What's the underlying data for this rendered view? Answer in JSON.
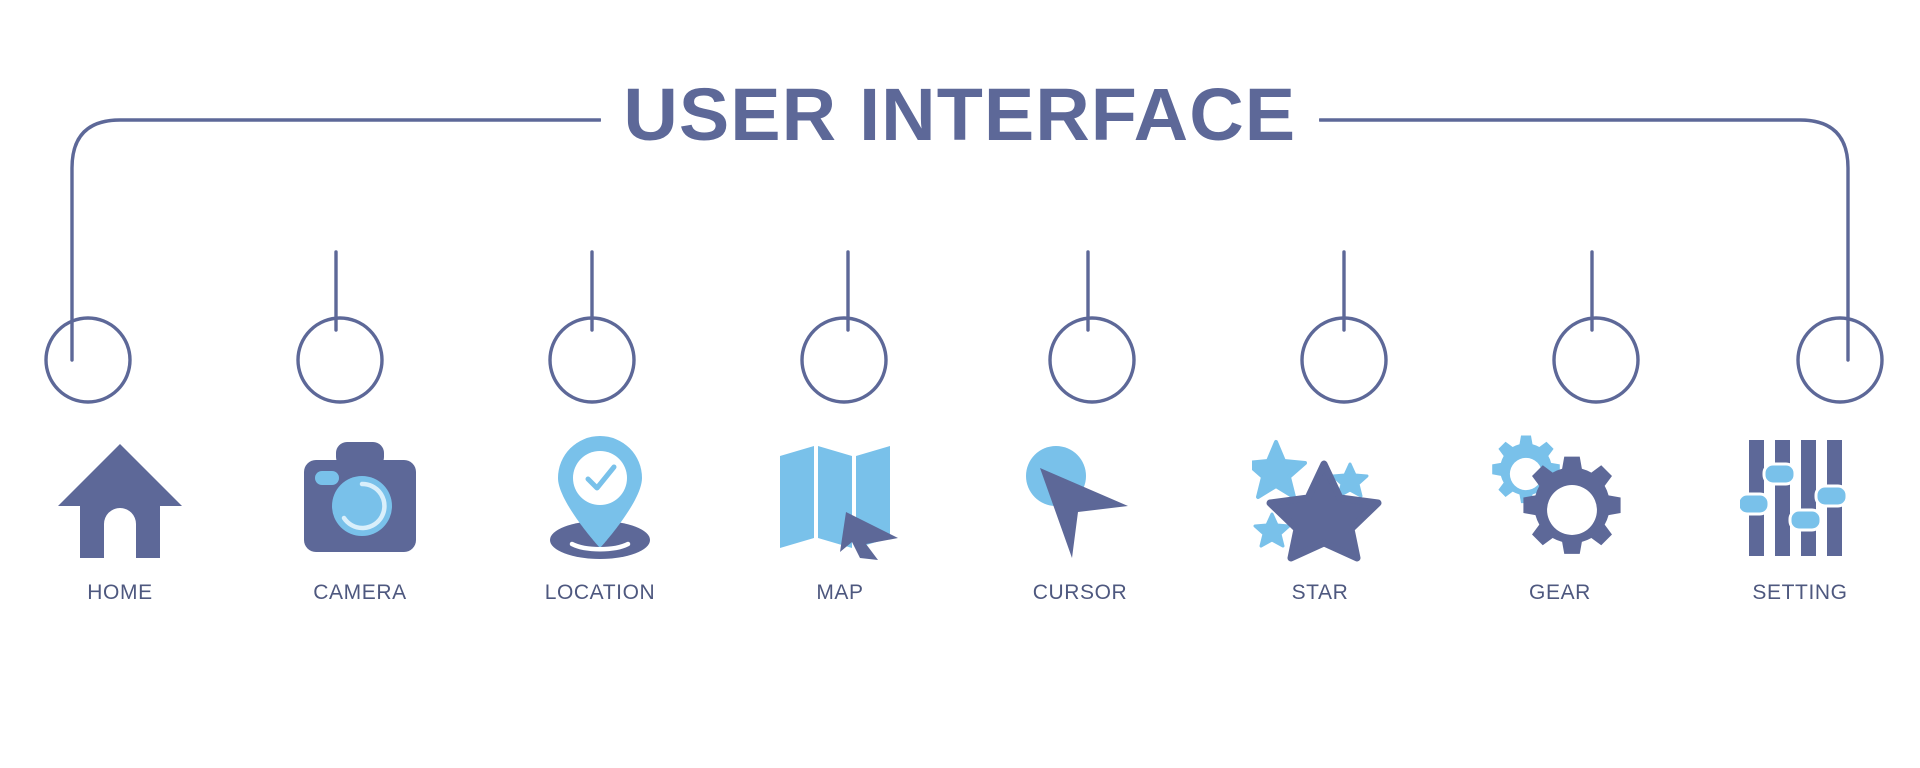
{
  "banner": {
    "title": "USER INTERFACE",
    "background_color": "#ffffff",
    "dark_color": "#5d6898",
    "light_color": "#79c1ea",
    "line_color": "#5d6898",
    "label_color": "#4e587f"
  },
  "items": [
    {
      "label": "HOME",
      "icon": "home-icon"
    },
    {
      "label": "CAMERA",
      "icon": "camera-icon"
    },
    {
      "label": "LOCATION",
      "icon": "location-pin-icon"
    },
    {
      "label": "MAP",
      "icon": "map-icon"
    },
    {
      "label": "CURSOR",
      "icon": "cursor-icon"
    },
    {
      "label": "STAR",
      "icon": "star-icon"
    },
    {
      "label": "GEAR",
      "icon": "gear-icon"
    },
    {
      "label": "SETTING",
      "icon": "sliders-setting-icon"
    }
  ]
}
